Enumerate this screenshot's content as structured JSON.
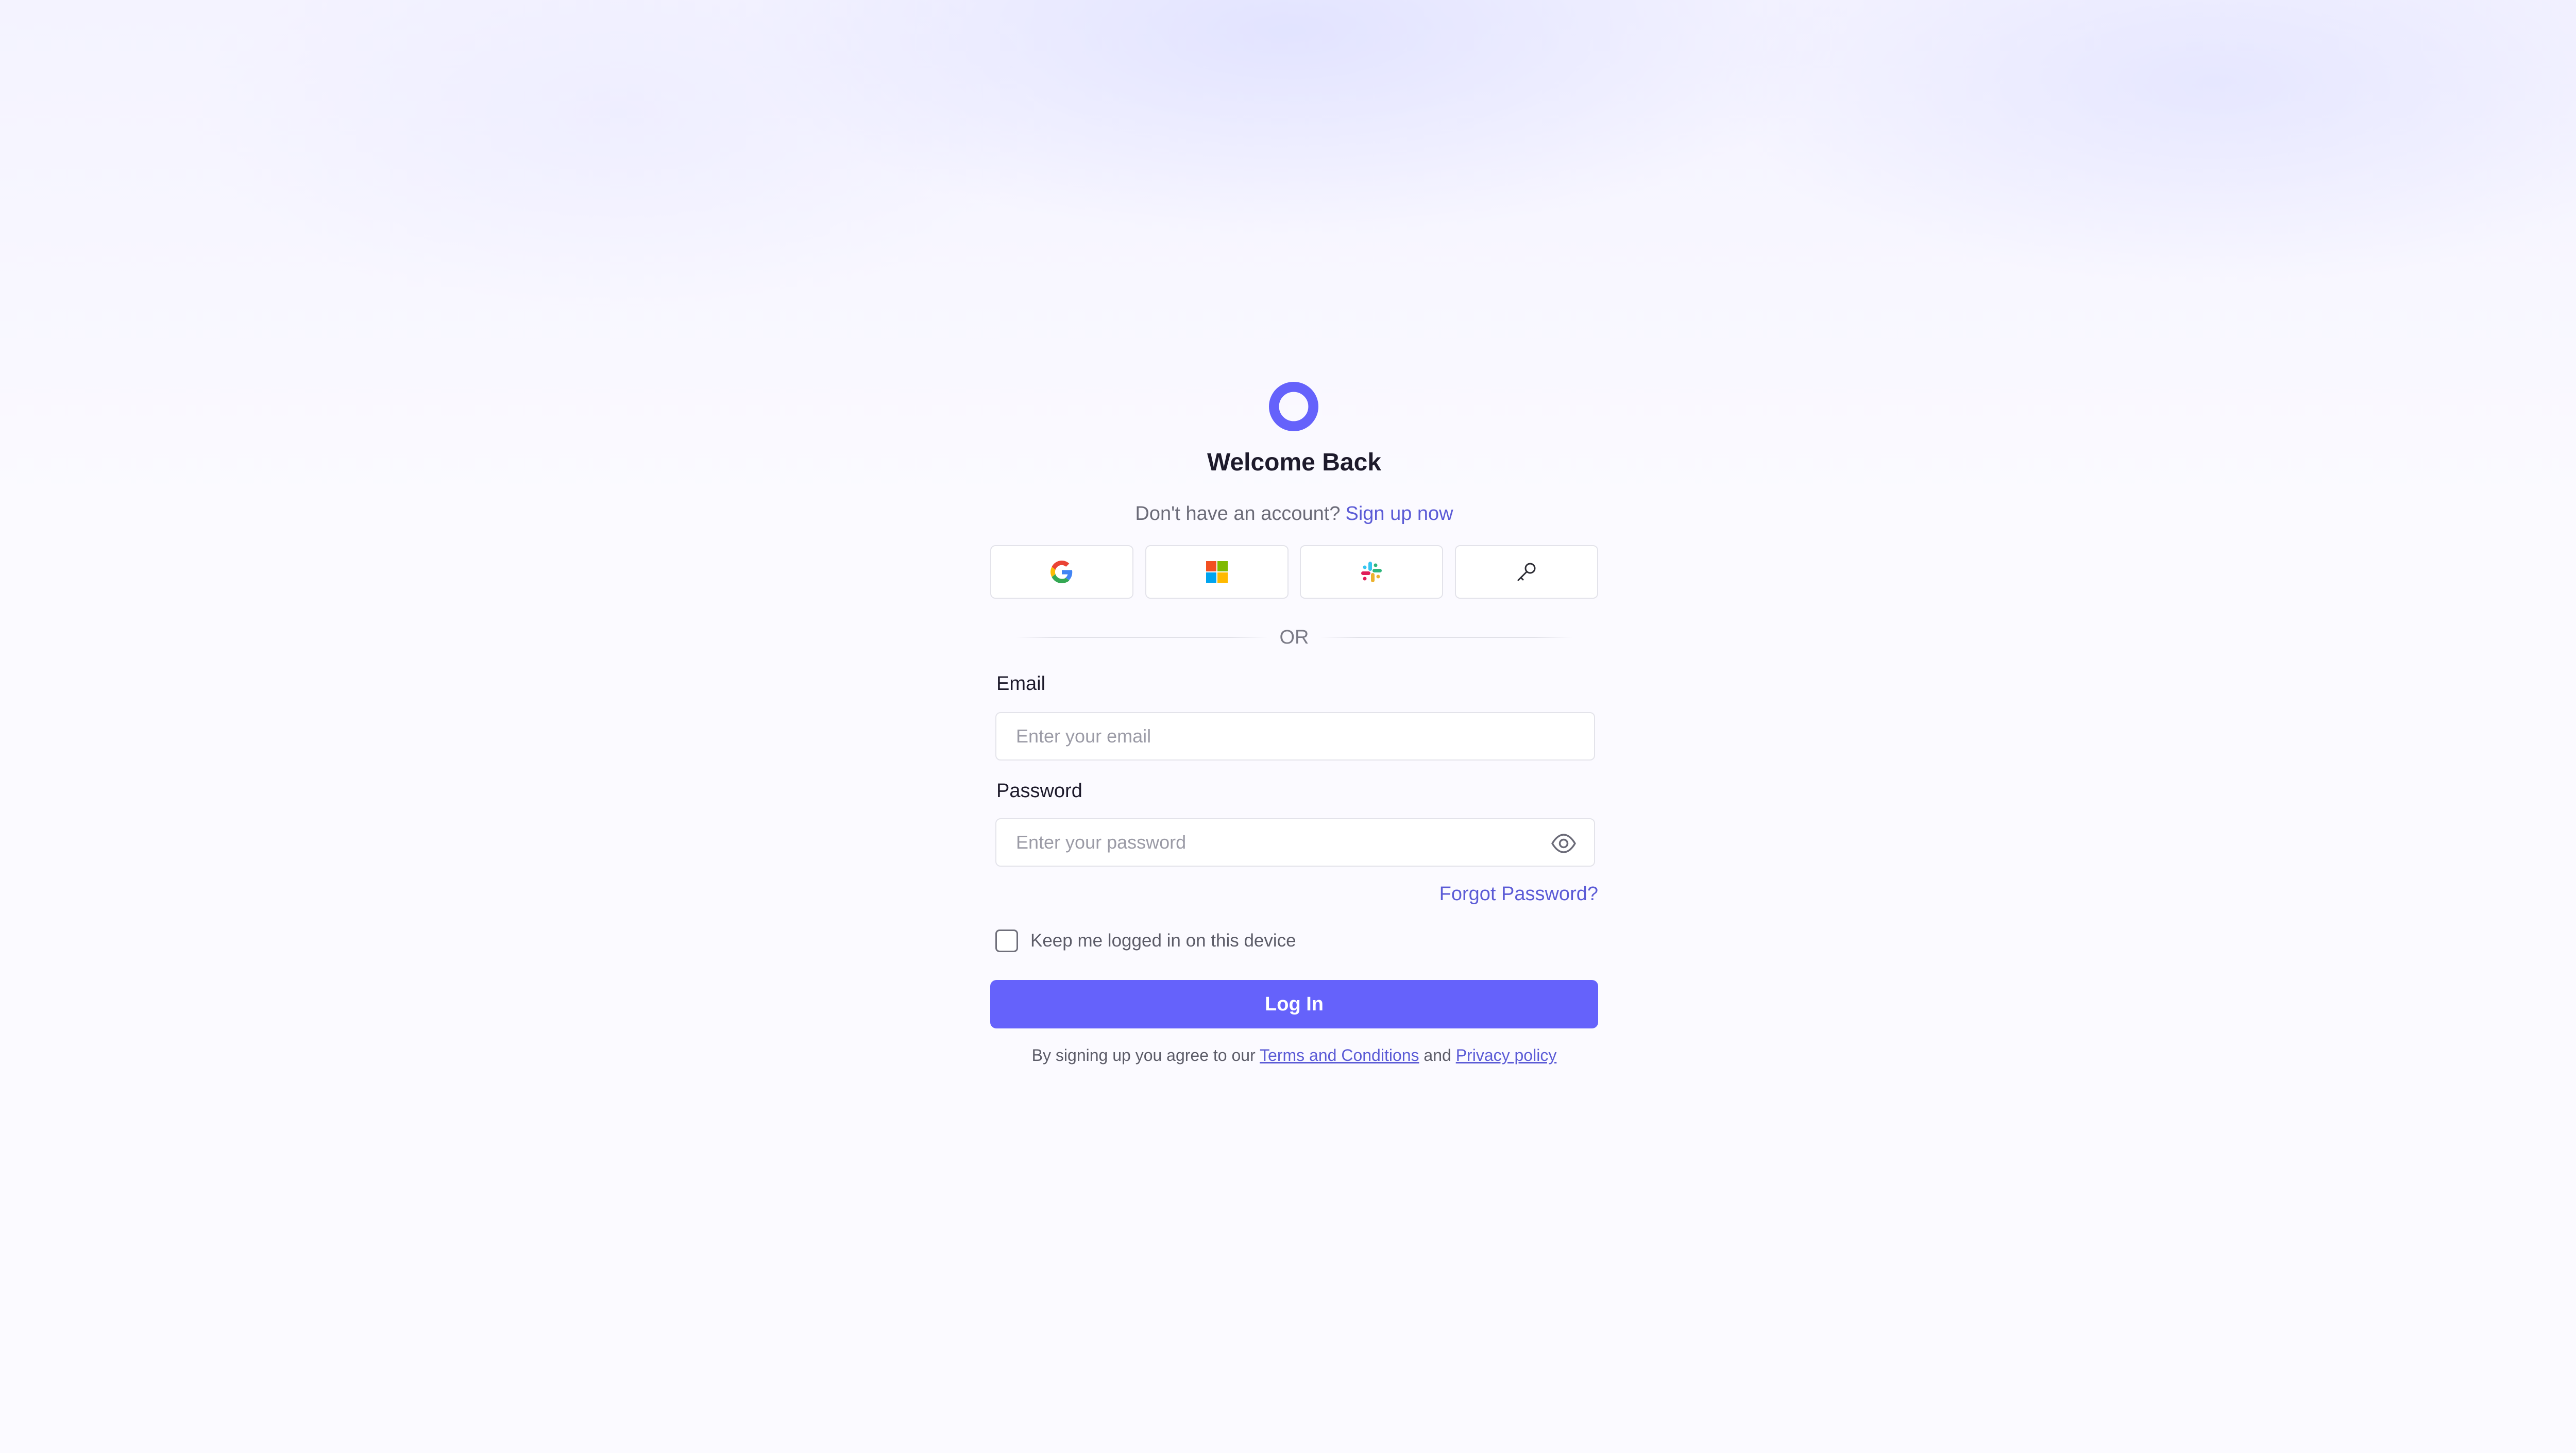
{
  "brand": {
    "logo_icon": "ring-logo-icon",
    "accent_color": "#6562fb",
    "link_color": "#5b5bd6"
  },
  "header": {
    "title": "Welcome Back",
    "no_account_text": "Don't have an account?",
    "signup_link": "Sign up now"
  },
  "providers": [
    {
      "name": "google",
      "icon": "google-icon"
    },
    {
      "name": "microsoft",
      "icon": "microsoft-icon"
    },
    {
      "name": "slack",
      "icon": "slack-icon"
    },
    {
      "name": "sso",
      "icon": "key-icon"
    }
  ],
  "divider": {
    "text": "OR"
  },
  "form": {
    "email_label": "Email",
    "email_placeholder": "Enter your email",
    "email_value": "",
    "password_label": "Password",
    "password_placeholder": "Enter your password",
    "password_value": "",
    "password_toggle_icon": "eye-icon",
    "forgot_password": "Forgot Password?",
    "remember_label": "Keep me logged in on this device",
    "remember_checked": false,
    "login_button": "Log In"
  },
  "footer": {
    "agree_text": "By signing up you agree to our",
    "terms_link": "Terms and Conditions",
    "and_text": "and",
    "privacy_link": "Privacy policy"
  }
}
